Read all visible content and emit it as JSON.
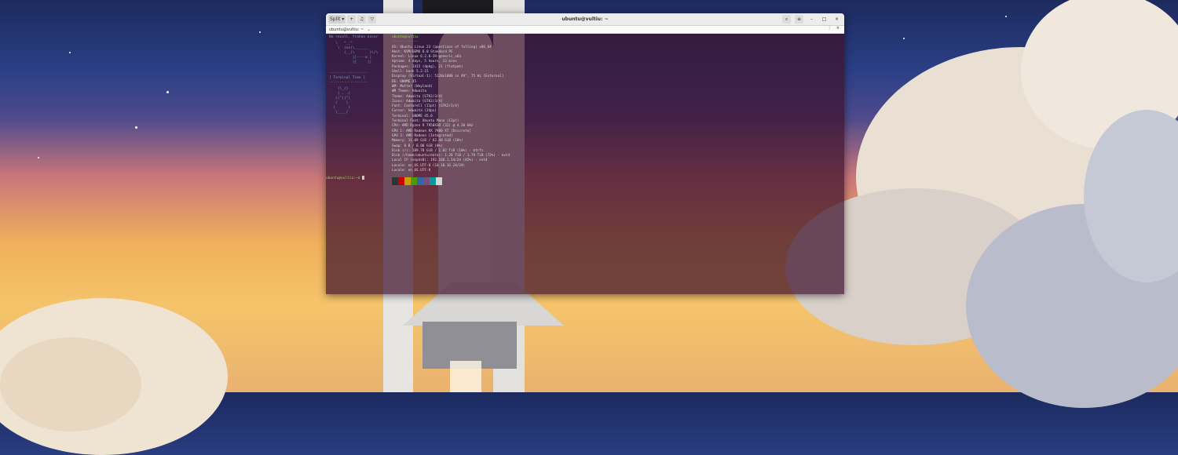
{
  "window": {
    "title": "ubuntu@vultiu: ~",
    "left_buttons": [
      "Split",
      "+",
      "♫",
      "▽"
    ],
    "right_buttons": [
      "⌕",
      "≡",
      "–",
      "□",
      "×"
    ]
  },
  "tabbar": {
    "tab_label": "ubuntu@vultiu: ~",
    "tab_dropdown": "⌄",
    "right_icons": [
      "⋮",
      "×"
    ]
  },
  "left_pane": {
    "speech": "No recall, frahan occur",
    "cow_art": [
      "   \\   ^__^",
      "    \\  (oo)\\_______",
      "       (__)\\       )\\/\\",
      "           ||----w |",
      "           ||     ||"
    ],
    "separator_top": "------------------",
    "banner": "[  Terminal Time ]",
    "separator_bottom": "------------------",
    "bunny_art": [
      "    (\\_/)",
      "    ( . .)",
      "   c(\")(\")",
      "   /    \\",
      "  (      )",
      "   \\____/"
    ],
    "prompt": "ubuntu@vultiu:~$ "
  },
  "right_pane": {
    "header": "ubuntu@vultiu",
    "divider": "-------------",
    "info_lines": [
      "OS: Ubuntu Linux 23 (questions of falling) x86_64",
      "Host: KVM/QEMU 8.0 Standard PC",
      "Kernel: Linux 6.2.0-39-generic_x64",
      "Uptime: 4 days, 5 hours, 13 mins",
      "Packages: 2415 (dpkg), 21 (flatpak)",
      "Shell: bash 5.2.15",
      "Display (Virtual-1): 5120x1080 in 49\", 75 Hz [External]",
      "DE: GNOME 45",
      "WM: Mutter (Wayland)",
      "WM Theme: Adwaita",
      "Theme: Adwaita [GTK2/3/4]",
      "Icons: Adwaita [GTK2/3/4]",
      "Font: Cantarell (11pt) [GTK2/3/4]",
      "Cursor: Adwaita (24px)",
      "Terminal: GNOME 45.0",
      "Terminal Font: Ubuntu Mono (13pt)",
      "CPU: AMD Ryzen 9 7950X3D (32) @ 4.20 GHz",
      "GPU 1: AMD Radeon RX 7900 XT [Discrete]",
      "GPU 2: AMD Radeon [Integrated]",
      "Memory: 11.09 GiB / 62.48 GiB (18%)",
      "Swap: 0 B / 8.00 GiB (0%)",
      "Disk (/): 189.78 GiB / 1.82 TiB (10%) - btrfs",
      "Disk (/home/ubuntu/data): 1.28 TiB / 1.79 TiB (72%) - ext4",
      "Local IP (enp4s0): 192.168.1.54/24 (82%) - ext4",
      "Locale: en_US.UTF-8 (10.10.16.24/24)",
      "Locale: en_US.UTF-8"
    ],
    "palette": [
      "#2e3436",
      "#cc0000",
      "#c4a000",
      "#4e9a06",
      "#3465a4",
      "#75507b",
      "#06989a",
      "#d3d7cf"
    ]
  }
}
